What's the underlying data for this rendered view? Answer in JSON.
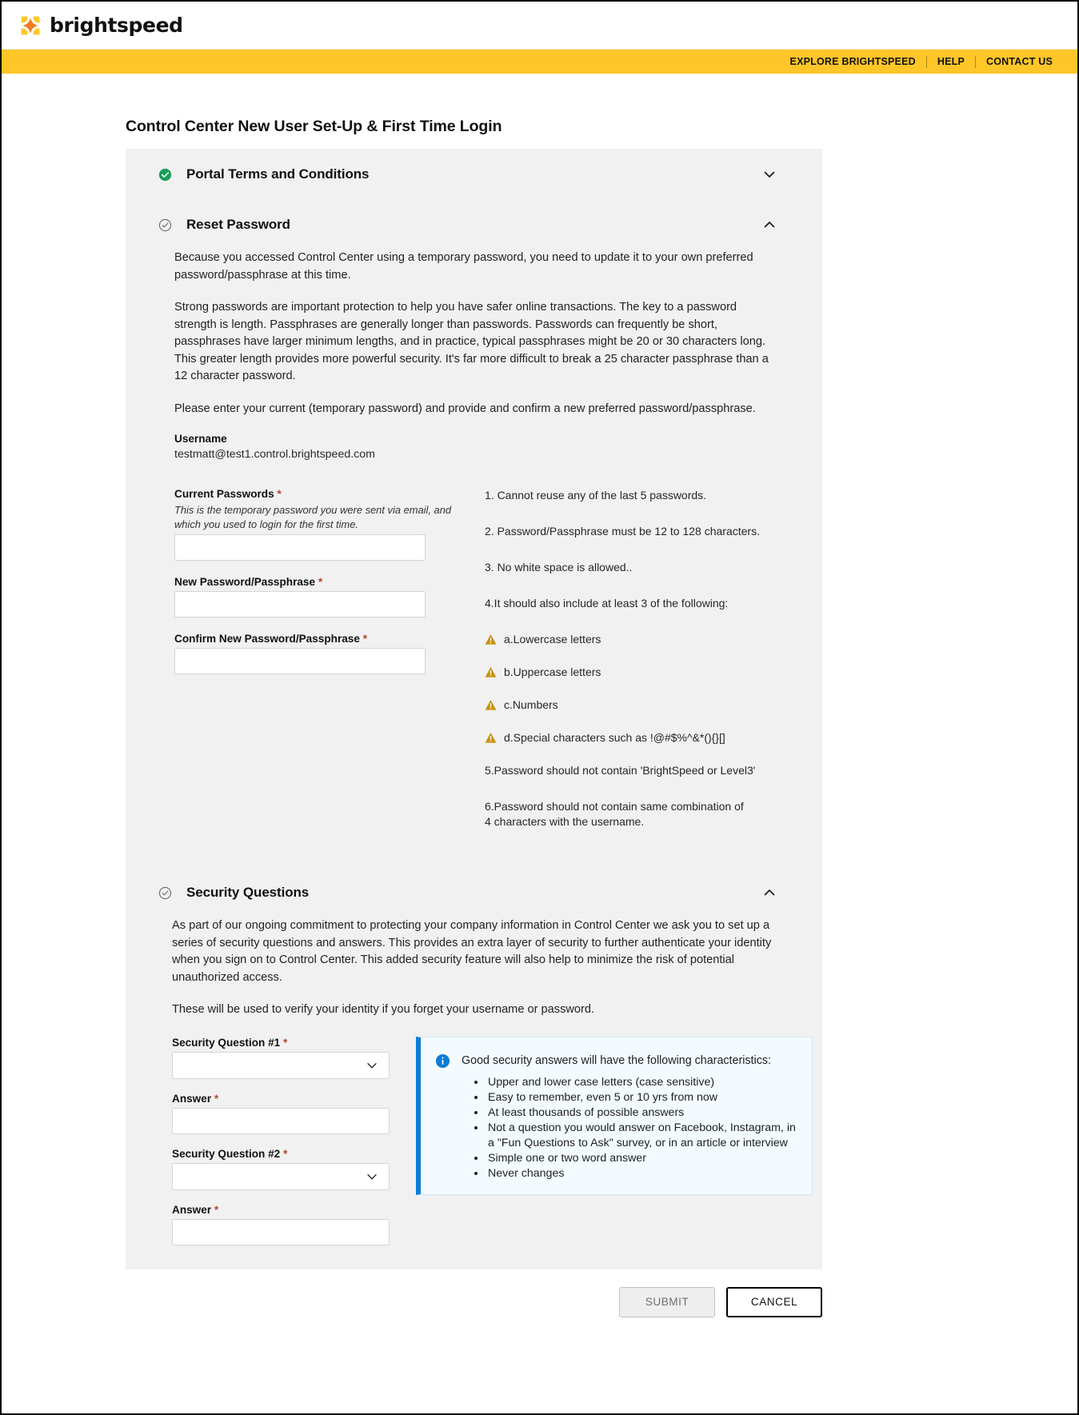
{
  "brand": {
    "name": "brightspeed",
    "logo_icon": "brightspeed-sparkle-logo",
    "logo_colors": [
      "#f5a623",
      "#ffc627",
      "#ff6b35"
    ]
  },
  "utility_nav": {
    "items": [
      {
        "label": "EXPLORE BRIGHTSPEED"
      },
      {
        "label": "HELP"
      },
      {
        "label": "CONTACT US"
      }
    ],
    "background": "#ffc627"
  },
  "page": {
    "title": "Control Center New User Set-Up & First Time Login"
  },
  "sections": {
    "terms": {
      "title": "Portal Terms and Conditions",
      "status_icon": "check-circle-filled",
      "status_color": "#1a9e5c",
      "chevron": "chevron-down-icon",
      "expanded": false
    },
    "reset_password": {
      "title": "Reset Password",
      "status_icon": "check-circle-outline",
      "status_color": "#6b6b6b",
      "chevron": "chevron-up-icon",
      "expanded": true,
      "paragraphs": [
        "Because you accessed Control Center using a temporary password, you need to update it to your own preferred password/passphrase at this time.",
        "Strong passwords are important protection to help you have safer online transactions. The key to a password strength is length. Passphrases are generally longer than passwords. Passwords can frequently be short, passphrases have larger minimum lengths, and in practice, typical passphrases might be 20 or 30 characters long. This greater length provides more powerful security. It's far more difficult to break a 25 character passphrase than a 12 character password.",
        "Please enter your current (temporary password) and provide and confirm a new preferred password/passphrase."
      ],
      "username_label": "Username",
      "username_value": "testmatt@test1.control.brightspeed.com",
      "fields": [
        {
          "label": "Current Passwords",
          "required": "*",
          "hint": "This is the temporary password you were sent via email, and which you used to login for the first time.",
          "value": "",
          "placeholder": ""
        },
        {
          "label": "New Password/Passphrase",
          "required": "*",
          "hint": "",
          "value": "",
          "placeholder": ""
        },
        {
          "label": "Confirm New Password/Passphrase",
          "required": "*",
          "hint": "",
          "value": "",
          "placeholder": ""
        }
      ],
      "rules": [
        {
          "text": "1. Cannot reuse any of the last 5 passwords.",
          "icon": ""
        },
        {
          "text": "2. Password/Passphrase must be 12 to 128 characters.",
          "icon": ""
        },
        {
          "text": "3. No white space is allowed..",
          "icon": ""
        },
        {
          "text": "4.It should also include at least 3 of the following:",
          "icon": ""
        },
        {
          "text": "a.Lowercase letters",
          "icon": "warning-triangle-icon"
        },
        {
          "text": "b.Uppercase letters",
          "icon": "warning-triangle-icon"
        },
        {
          "text": "c.Numbers",
          "icon": "warning-triangle-icon"
        },
        {
          "text": "d.Special characters such as !@#$%^&*(){}[]",
          "icon": "warning-triangle-icon"
        },
        {
          "text": "5.Password should not contain 'BrightSpeed or Level3'",
          "icon": ""
        },
        {
          "text": "6.Password should not contain same combination of 4 characters with the username.",
          "icon": ""
        }
      ]
    },
    "security_questions": {
      "title": "Security Questions",
      "status_icon": "check-circle-outline",
      "status_color": "#6b6b6b",
      "chevron": "chevron-up-icon",
      "expanded": true,
      "paragraphs": [
        "As part of our ongoing commitment to protecting your company information in Control Center we ask you to set up a series of security questions and answers. This provides an extra layer of security to further authenticate your identity when you sign on to Control Center. This added security feature will also help to minimize the risk of potential unauthorized access.",
        "These will be used to verify your identity if you forget your username or password."
      ],
      "fields": [
        {
          "label": "Security Question #1",
          "required": "*",
          "type": "select",
          "value": "",
          "chevron": "chevron-down-icon"
        },
        {
          "label": "Answer",
          "required": "*",
          "type": "text",
          "value": ""
        },
        {
          "label": "Security Question #2",
          "required": "*",
          "type": "select",
          "value": "",
          "chevron": "chevron-down-icon"
        },
        {
          "label": "Answer",
          "required": "*",
          "type": "text",
          "value": ""
        }
      ],
      "info_panel": {
        "icon": "info-circle-icon",
        "accent_color": "#0c7cd5",
        "heading": "Good security answers will have the following characteristics:",
        "bullets": [
          "Upper and lower case letters (case sensitive)",
          "Easy to remember, even 5 or 10 yrs from now",
          "At least thousands of possible answers",
          "Not a question you would answer on Facebook, Instagram, in a \"Fun Questions to Ask\" survey, or in an article or interview",
          "Simple one or two word answer",
          "Never changes"
        ]
      }
    }
  },
  "footer": {
    "submit_label": "SUBMIT",
    "cancel_label": "CANCEL"
  }
}
